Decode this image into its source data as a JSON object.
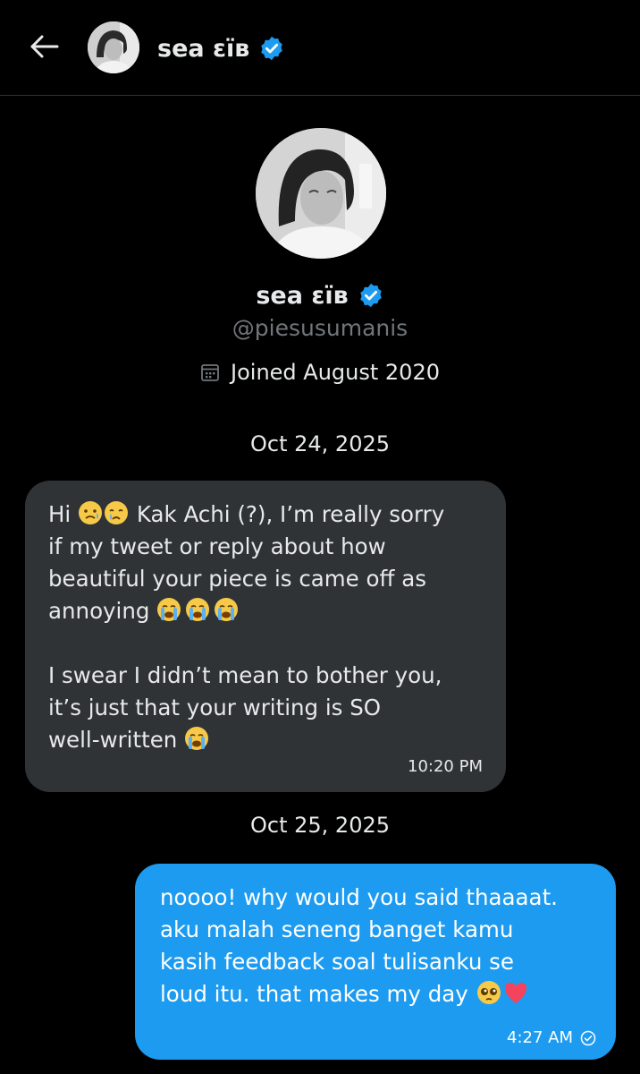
{
  "header": {
    "name": "sea εïв",
    "verified_icon": "verified-badge-icon",
    "back_icon": "arrow-left-icon"
  },
  "profile": {
    "name": "sea εïв",
    "handle": "@piesusumanis",
    "joined": "Joined August 2020",
    "calendar_icon": "calendar-icon"
  },
  "conversation": {
    "date1": "Oct 24, 2025",
    "msg1": {
      "line1_a": "Hi ",
      "line1_b": " Kak Achi (?), I’m really sorry",
      "line2": "if my tweet or reply about how",
      "line3": "beautiful your piece is came off as",
      "line4": "annoying ",
      "line6": "I swear I didn’t mean to bother you,",
      "line7": "it’s just that your writing is SO",
      "line8": "well-written ",
      "time": "10:20 PM"
    },
    "date2": "Oct 25, 2025",
    "msg2": {
      "line1": "noooo! why would you said thaaaat.",
      "line2": "aku malah seneng banget kamu",
      "line3": "kasih feedback soal tulisanku se",
      "line4": "loud itu. that makes my day ",
      "time": "4:27 AM",
      "status_icon": "check-circle-icon"
    }
  },
  "colors": {
    "background": "#000000",
    "incoming_bubble": "#2f3336",
    "outgoing_bubble": "#1d9bf0",
    "verified": "#1d9bf0",
    "muted_text": "#71767b"
  }
}
